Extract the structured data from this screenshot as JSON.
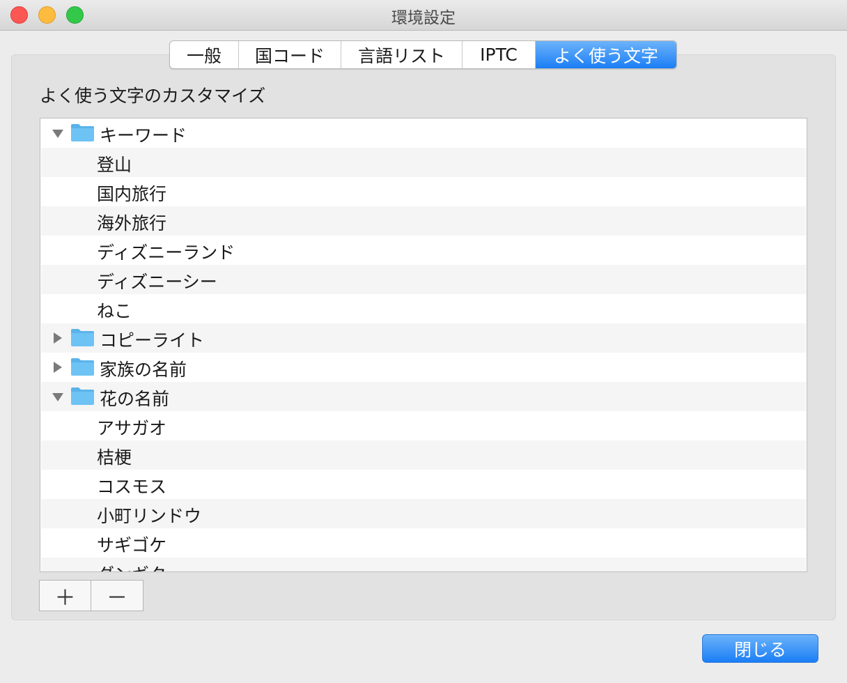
{
  "window": {
    "title": "環境設定"
  },
  "tabs": [
    {
      "label": "一般"
    },
    {
      "label": "国コード"
    },
    {
      "label": "言語リスト"
    },
    {
      "label": "IPTC"
    },
    {
      "label": "よく使う文字",
      "selected": true
    }
  ],
  "section": {
    "title": "よく使う文字のカスタマイズ"
  },
  "outline": {
    "rows": [
      {
        "label": "キーワード",
        "type": "group",
        "expanded": true
      },
      {
        "label": "登山",
        "type": "child"
      },
      {
        "label": "国内旅行",
        "type": "child"
      },
      {
        "label": "海外旅行",
        "type": "child"
      },
      {
        "label": "ディズニーランド",
        "type": "child"
      },
      {
        "label": "ディズニーシー",
        "type": "child"
      },
      {
        "label": "ねこ",
        "type": "child"
      },
      {
        "label": "コピーライト",
        "type": "group",
        "expanded": false
      },
      {
        "label": "家族の名前",
        "type": "group",
        "expanded": false
      },
      {
        "label": "花の名前",
        "type": "group",
        "expanded": true
      },
      {
        "label": "アサガオ",
        "type": "child"
      },
      {
        "label": "桔梗",
        "type": "child"
      },
      {
        "label": "コスモス",
        "type": "child"
      },
      {
        "label": "小町リンドウ",
        "type": "child"
      },
      {
        "label": "サギゴケ",
        "type": "child"
      },
      {
        "label": "ダンギク",
        "type": "child"
      }
    ]
  },
  "buttons": {
    "add": "＋",
    "remove": "－",
    "close": "閉じる"
  },
  "icons": {
    "folder": "folder-icon",
    "expanded": "disclosure-expanded-icon",
    "collapsed": "disclosure-collapsed-icon"
  },
  "colors": {
    "accent": "#1b7ef5",
    "folder": "#6ec3f5"
  }
}
